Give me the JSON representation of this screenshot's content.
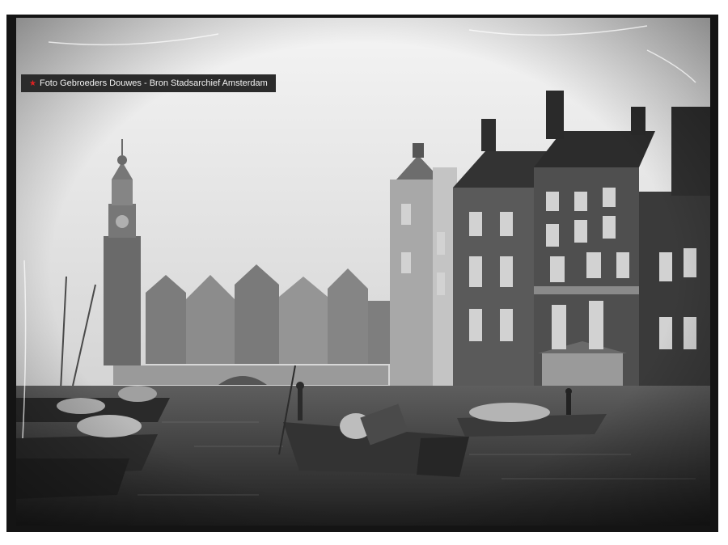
{
  "photo": {
    "credit_star": "★",
    "credit": "Foto Gebroeders Douwes - Bron Stadsarchief Amsterdam"
  },
  "colors": {
    "sky": "#e6e6e6",
    "water": "#3a3a3a",
    "building_dark": "#3d3d3d",
    "building_mid": "#6e6e6e",
    "frame": "#141414"
  }
}
